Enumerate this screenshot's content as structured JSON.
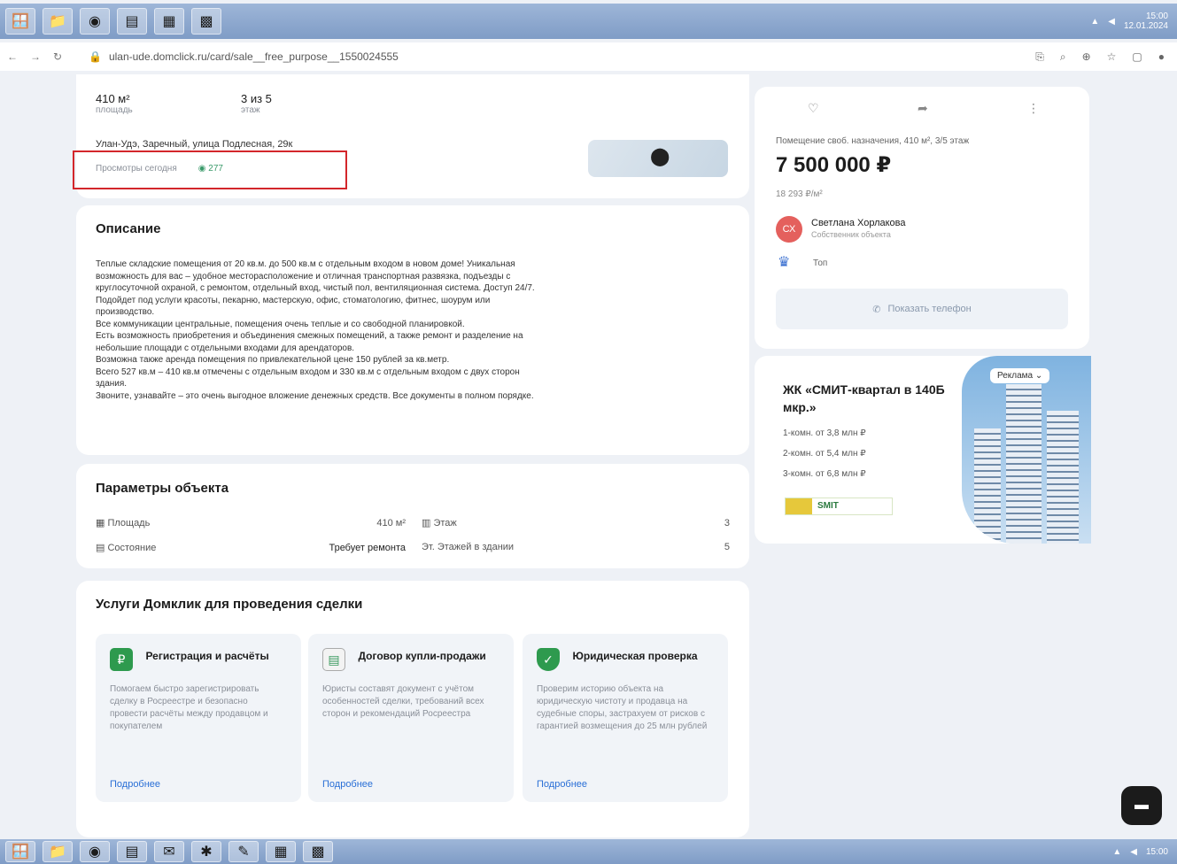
{
  "property": {
    "area_value": "410 м²",
    "area_label": "площадь",
    "floor_value": "3 из 5",
    "floor_label": "этаж",
    "address": "Улан-Удэ, Заречный, улица Подлесная, 29к",
    "views_label": "Просмотры сегодня",
    "views_count": "277"
  },
  "description": {
    "heading": "Описание",
    "lines": [
      "Теплые складские помещения от 20 кв.м. до 500 кв.м с отдельным входом в новом доме! Уникальная",
      "возможность для вас – удобное месторасположение и отличная транспортная развязка, подъезды с",
      "круглосуточной охраной, с ремонтом, отдельный вход, чистый пол, вентиляционная система. Доступ 24/7.",
      "Подойдет под услуги красоты, пекарню, мастерскую, офис, стоматологию, фитнес, шоурум или",
      "производство.",
      "Все коммуникации центральные, помещения очень теплые и со свободной планировкой.",
      "Есть возможность приобретения и объединения смежных помещений, а также ремонт и разделение на",
      "небольшие площади с отдельными входами для арендаторов.",
      "Возможна также аренда помещения по привлекательной цене 150 рублей за кв.метр.",
      "Всего 527 кв.м – 410 кв.м отмечены с отдельным входом и 330 кв.м с отдельным входом с двух сторон",
      "здания.",
      "Звоните, узнавайте – это очень выгодное вложение денежных средств. Все документы в полном порядке."
    ]
  },
  "params": {
    "heading": "Параметры объекта",
    "area_label": "Площадь",
    "area_value": "410 м²",
    "floor_label": "Этаж",
    "floor_value": "3",
    "state_label": "Состояние",
    "state_value": "Требует ремонта",
    "floors_label": "Эт. Этажей в здании",
    "floors_value": "5"
  },
  "services": {
    "heading": "Услуги Домклик для проведения сделки",
    "items": [
      {
        "title": "Регистрация и расчёты",
        "text": "Помогаем быстро зарегистрировать сделку в Росреестре и безопасно провести расчёты между продавцом и покупателем",
        "more": "Подробнее"
      },
      {
        "title": "Договор купли-продажи",
        "text": "Юристы составят документ с учётом особенностей сделки, требований всех сторон и рекомендаций Росреестра",
        "more": "Подробнее"
      },
      {
        "title": "Юридическая проверка",
        "text": "Проверим историю объекта на юридическую чистоту и продавца на судебные споры, застрахуем от рисков с гарантией возмещения до 25 млн рублей",
        "more": "Подробнее"
      }
    ]
  },
  "sidebar": {
    "subtitle": "Помещение своб. назначения, 410 м², 3/5 этаж",
    "price": "7 500 000 ₽",
    "price_per_m": "18 293 ₽/м²",
    "seller_initials": "СХ",
    "seller_name": "Светлана Хорлакова",
    "seller_sub": "Собственник объекта",
    "badge_label": "Топ",
    "phone_button": "Показать телефон"
  },
  "ad": {
    "title": "ЖК «СМИТ-квартал в 140Б мкр.»",
    "line1": "1-комн. от 3,8 млн ₽",
    "line2": "2-комн. от 5,4 млн ₽",
    "line3": "3-комн. от 6,8 млн ₽",
    "brand": "SMIT",
    "tag": "Реклама"
  },
  "browser": {
    "url": "ulan-ude.domclick.ru/card/sale__free_purpose__1550024555"
  },
  "taskbar": {
    "time": "15:00",
    "date": "12.01.2024"
  }
}
